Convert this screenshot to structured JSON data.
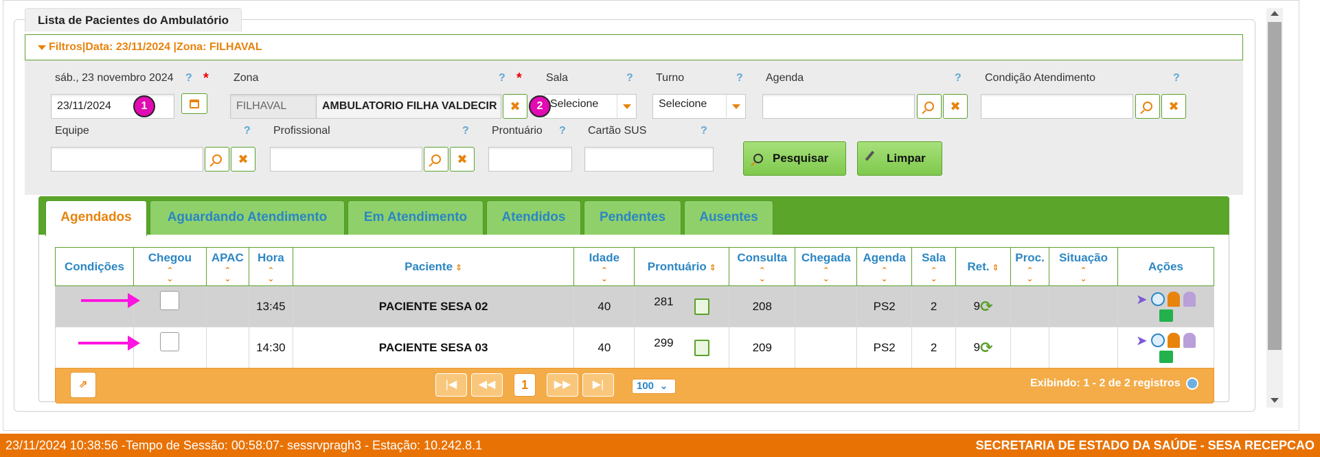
{
  "panel": {
    "title": "Lista de Pacientes do Ambulatório"
  },
  "filters": {
    "header": "Filtros|Data: 23/11/2024 |Zona: FILHAVAL",
    "date_label": "sáb., 23 novembro 2024",
    "date_value": "23/11/2024",
    "zona_label": "Zona",
    "zona_code": "FILHAVAL",
    "zona_name": "AMBULATORIO FILHA VALDECIR",
    "sala_label": "Sala",
    "sala_value": "Selecione",
    "turno_label": "Turno",
    "turno_value": "Selecione",
    "agenda_label": "Agenda",
    "condicao_label": "Condição Atendimento",
    "equipe_label": "Equipe",
    "profissional_label": "Profissional",
    "prontuario_label": "Prontuário",
    "cartao_label": "Cartão SUS",
    "help": "?",
    "required": "*",
    "search_button": "Pesquisar",
    "clear_button": "Limpar",
    "marker_1": "1",
    "marker_2": "2"
  },
  "tabs": [
    {
      "label": "Agendados",
      "active": true
    },
    {
      "label": "Aguardando Atendimento"
    },
    {
      "label": "Em Atendimento"
    },
    {
      "label": "Atendidos"
    },
    {
      "label": "Pendentes"
    },
    {
      "label": "Ausentes"
    }
  ],
  "table": {
    "columns": [
      "Condições",
      "Chegou",
      "APAC",
      "Hora",
      "Paciente",
      "Idade",
      "Prontuário",
      "Consulta",
      "Chegada",
      "Agenda",
      "Sala",
      "Ret.",
      "Proc.",
      "Situação",
      "Ações"
    ],
    "rows": [
      {
        "hora": "13:45",
        "paciente": "PACIENTE SESA 02",
        "idade": "40",
        "prontuario": "281",
        "consulta": "208",
        "agenda": "PS2",
        "sala": "2",
        "ret": "9"
      },
      {
        "hora": "14:30",
        "paciente": "PACIENTE SESA 03",
        "idade": "40",
        "prontuario": "299",
        "consulta": "209",
        "agenda": "PS2",
        "sala": "2",
        "ret": "9"
      }
    ]
  },
  "pager": {
    "current_page": "1",
    "page_size": "100",
    "summary": "Exibindo: 1 - 2 de 2 registros"
  },
  "statusbar": {
    "left": "23/11/2024 10:38:56 -Tempo de Sessão: 00:58:07- sessrvpragh3 - Estação: 10.242.8.1",
    "right": "SECRETARIA DE ESTADO DA SAÚDE - SESA RECEPCAO"
  },
  "colors": {
    "accent_orange": "#e8830c",
    "accent_green": "#5aa52a",
    "link_blue": "#2b86c4",
    "status_bar": "#e97204",
    "marker": "#ff14e0"
  }
}
